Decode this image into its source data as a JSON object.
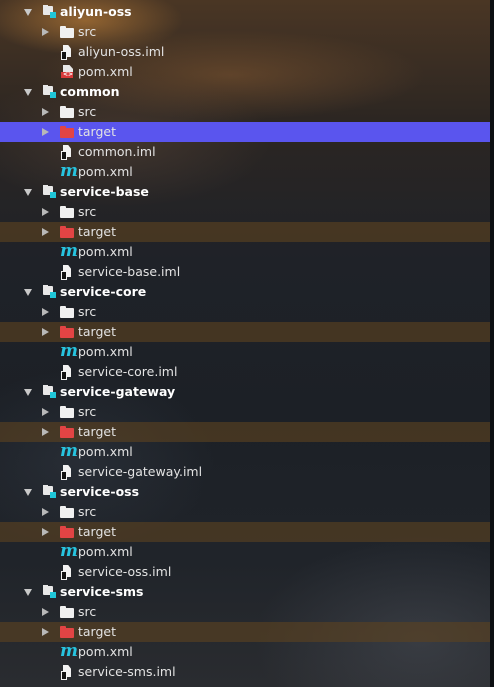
{
  "tree": {
    "items": [
      {
        "label": "aliyun-oss",
        "icon": "module-icon",
        "depth": 0,
        "expand": "down",
        "bold": true
      },
      {
        "label": "src",
        "icon": "folder-icon",
        "depth": 1,
        "expand": "right"
      },
      {
        "label": "aliyun-oss.iml",
        "icon": "iml-file-icon",
        "depth": 1
      },
      {
        "label": "pom.xml",
        "icon": "pom-error-icon",
        "depth": 1
      },
      {
        "label": "common",
        "icon": "module-icon",
        "depth": 0,
        "expand": "down",
        "bold": true
      },
      {
        "label": "src",
        "icon": "folder-icon",
        "depth": 1,
        "expand": "right"
      },
      {
        "label": "target",
        "icon": "excluded-folder-icon",
        "depth": 1,
        "expand": "right",
        "selected": true
      },
      {
        "label": "common.iml",
        "icon": "iml-file-icon",
        "depth": 1
      },
      {
        "label": "pom.xml",
        "icon": "maven-icon",
        "depth": 1
      },
      {
        "label": "service-base",
        "icon": "module-icon",
        "depth": 0,
        "expand": "down",
        "bold": true
      },
      {
        "label": "src",
        "icon": "folder-icon",
        "depth": 1,
        "expand": "right"
      },
      {
        "label": "target",
        "icon": "excluded-folder-icon",
        "depth": 1,
        "expand": "right",
        "highlight": true
      },
      {
        "label": "pom.xml",
        "icon": "maven-icon",
        "depth": 1
      },
      {
        "label": "service-base.iml",
        "icon": "iml-file-icon",
        "depth": 1
      },
      {
        "label": "service-core",
        "icon": "module-icon",
        "depth": 0,
        "expand": "down",
        "bold": true
      },
      {
        "label": "src",
        "icon": "folder-icon",
        "depth": 1,
        "expand": "right"
      },
      {
        "label": "target",
        "icon": "excluded-folder-icon",
        "depth": 1,
        "expand": "right",
        "highlight": true
      },
      {
        "label": "pom.xml",
        "icon": "maven-icon",
        "depth": 1
      },
      {
        "label": "service-core.iml",
        "icon": "iml-file-icon",
        "depth": 1
      },
      {
        "label": "service-gateway",
        "icon": "module-icon",
        "depth": 0,
        "expand": "down",
        "bold": true
      },
      {
        "label": "src",
        "icon": "folder-icon",
        "depth": 1,
        "expand": "right"
      },
      {
        "label": "target",
        "icon": "excluded-folder-icon",
        "depth": 1,
        "expand": "right",
        "highlight": true
      },
      {
        "label": "pom.xml",
        "icon": "maven-icon",
        "depth": 1
      },
      {
        "label": "service-gateway.iml",
        "icon": "iml-file-icon",
        "depth": 1
      },
      {
        "label": "service-oss",
        "icon": "module-icon",
        "depth": 0,
        "expand": "down",
        "bold": true
      },
      {
        "label": "src",
        "icon": "folder-icon",
        "depth": 1,
        "expand": "right"
      },
      {
        "label": "target",
        "icon": "excluded-folder-icon",
        "depth": 1,
        "expand": "right",
        "highlight": true
      },
      {
        "label": "pom.xml",
        "icon": "maven-icon",
        "depth": 1
      },
      {
        "label": "service-oss.iml",
        "icon": "iml-file-icon",
        "depth": 1
      },
      {
        "label": "service-sms",
        "icon": "module-icon",
        "depth": 0,
        "expand": "down",
        "bold": true
      },
      {
        "label": "src",
        "icon": "folder-icon",
        "depth": 1,
        "expand": "right"
      },
      {
        "label": "target",
        "icon": "excluded-folder-icon",
        "depth": 1,
        "expand": "right",
        "highlight": true
      },
      {
        "label": "pom.xml",
        "icon": "maven-icon",
        "depth": 1
      },
      {
        "label": "service-sms.iml",
        "icon": "iml-file-icon",
        "depth": 1
      }
    ]
  },
  "colors": {
    "selection": "#5a55ee",
    "excluded_folder": "#e24444",
    "module_marker": "#1fc6d8",
    "maven": "#27c4e0"
  }
}
